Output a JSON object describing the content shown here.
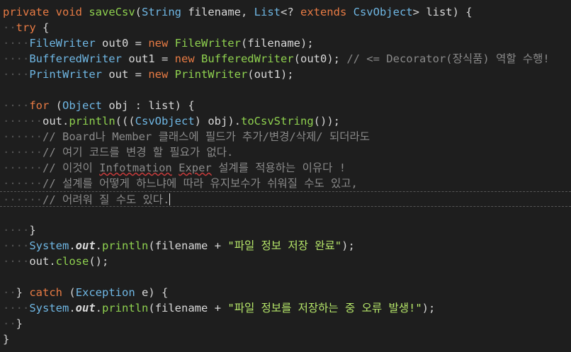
{
  "editor": {
    "language": "java",
    "lines": [
      [
        {
          "c": "kw",
          "t": "private "
        },
        {
          "c": "kw",
          "t": "void "
        },
        {
          "c": "fn",
          "t": "saveCsv"
        },
        {
          "c": "pun",
          "t": "("
        },
        {
          "c": "ty",
          "t": "String "
        },
        {
          "c": "var",
          "t": "filename"
        },
        {
          "c": "pun",
          "t": ", "
        },
        {
          "c": "ty",
          "t": "List"
        },
        {
          "c": "pun",
          "t": "<? "
        },
        {
          "c": "kw",
          "t": "extends "
        },
        {
          "c": "ty",
          "t": "CsvObject"
        },
        {
          "c": "pun",
          "t": "> "
        },
        {
          "c": "var",
          "t": "list"
        },
        {
          "c": "pun",
          "t": ") {"
        }
      ],
      [
        {
          "c": "ws",
          "t": "··"
        },
        {
          "c": "kw",
          "t": "try "
        },
        {
          "c": "pun",
          "t": "{"
        }
      ],
      [
        {
          "c": "ws",
          "t": "····"
        },
        {
          "c": "ty",
          "t": "FileWriter "
        },
        {
          "c": "var",
          "t": "out0 "
        },
        {
          "c": "pun",
          "t": "= "
        },
        {
          "c": "kw",
          "t": "new "
        },
        {
          "c": "fn",
          "t": "FileWriter"
        },
        {
          "c": "pun",
          "t": "("
        },
        {
          "c": "var",
          "t": "filename"
        },
        {
          "c": "pun",
          "t": ");"
        }
      ],
      [
        {
          "c": "ws",
          "t": "····"
        },
        {
          "c": "ty",
          "t": "BufferedWriter "
        },
        {
          "c": "var",
          "t": "out1 "
        },
        {
          "c": "pun",
          "t": "= "
        },
        {
          "c": "kw",
          "t": "new "
        },
        {
          "c": "fn",
          "t": "BufferedWriter"
        },
        {
          "c": "pun",
          "t": "("
        },
        {
          "c": "var",
          "t": "out0"
        },
        {
          "c": "pun",
          "t": "); "
        },
        {
          "c": "cmt",
          "t": "// <= Decorator(장식품) 역할 수행!"
        }
      ],
      [
        {
          "c": "ws",
          "t": "····"
        },
        {
          "c": "ty",
          "t": "PrintWriter "
        },
        {
          "c": "var",
          "t": "out "
        },
        {
          "c": "pun",
          "t": "= "
        },
        {
          "c": "kw",
          "t": "new "
        },
        {
          "c": "fn",
          "t": "PrintWriter"
        },
        {
          "c": "pun",
          "t": "("
        },
        {
          "c": "var",
          "t": "out1"
        },
        {
          "c": "pun",
          "t": ");"
        }
      ],
      [],
      [
        {
          "c": "ws",
          "t": "····"
        },
        {
          "c": "kw",
          "t": "for "
        },
        {
          "c": "pun",
          "t": "("
        },
        {
          "c": "ty",
          "t": "Object "
        },
        {
          "c": "var",
          "t": "obj "
        },
        {
          "c": "pun",
          "t": ": "
        },
        {
          "c": "var",
          "t": "list"
        },
        {
          "c": "pun",
          "t": ") {"
        }
      ],
      [
        {
          "c": "ws",
          "t": "······"
        },
        {
          "c": "var",
          "t": "out"
        },
        {
          "c": "pun",
          "t": "."
        },
        {
          "c": "fn",
          "t": "println"
        },
        {
          "c": "pun",
          "t": "((("
        },
        {
          "c": "ty",
          "t": "CsvObject"
        },
        {
          "c": "pun",
          "t": ") "
        },
        {
          "c": "var",
          "t": "obj"
        },
        {
          "c": "pun",
          "t": ")."
        },
        {
          "c": "fn",
          "t": "toCsvString"
        },
        {
          "c": "pun",
          "t": "());"
        }
      ],
      [
        {
          "c": "ws",
          "t": "······"
        },
        {
          "c": "cmt",
          "t": "// Board나 Member 클래스에 필드가 추가/변경/삭제/ 되더라도"
        }
      ],
      [
        {
          "c": "ws",
          "t": "······"
        },
        {
          "c": "cmt",
          "t": "// 여기 코드를 변경 할 필요가 없다."
        }
      ],
      [
        {
          "c": "ws",
          "t": "······"
        },
        {
          "c": "cmt",
          "t": "// 이것이 "
        },
        {
          "c": "cmt squiggle",
          "t": "Infotmation"
        },
        {
          "c": "cmt",
          "t": " "
        },
        {
          "c": "cmt squiggle",
          "t": "Exper"
        },
        {
          "c": "cmt",
          "t": " 설계를 적용하는 이유다 !"
        }
      ],
      [
        {
          "c": "ws",
          "t": "······"
        },
        {
          "c": "cmt",
          "t": "// 설계를 어떻게 하느냐에 따라 유지보수가 쉬워질 수도 있고,"
        }
      ],
      [
        {
          "c": "ws",
          "t": "······"
        },
        {
          "c": "cmt",
          "t": "// 어려워 질 수도 있다."
        }
      ],
      [],
      [
        {
          "c": "ws",
          "t": "····"
        },
        {
          "c": "pun",
          "t": "}"
        }
      ],
      [
        {
          "c": "ws",
          "t": "····"
        },
        {
          "c": "ty",
          "t": "System"
        },
        {
          "c": "pun",
          "t": "."
        },
        {
          "c": "field",
          "t": "out"
        },
        {
          "c": "pun",
          "t": "."
        },
        {
          "c": "fn",
          "t": "println"
        },
        {
          "c": "pun",
          "t": "("
        },
        {
          "c": "var",
          "t": "filename "
        },
        {
          "c": "pun",
          "t": "+ "
        },
        {
          "c": "str",
          "t": "\"파일 정보 저장 완료\""
        },
        {
          "c": "pun",
          "t": ");"
        }
      ],
      [
        {
          "c": "ws",
          "t": "····"
        },
        {
          "c": "var",
          "t": "out"
        },
        {
          "c": "pun",
          "t": "."
        },
        {
          "c": "fn",
          "t": "close"
        },
        {
          "c": "pun",
          "t": "();"
        }
      ],
      [],
      [
        {
          "c": "ws",
          "t": "··"
        },
        {
          "c": "pun",
          "t": "} "
        },
        {
          "c": "kw",
          "t": "catch "
        },
        {
          "c": "pun",
          "t": "("
        },
        {
          "c": "ty",
          "t": "Exception "
        },
        {
          "c": "var",
          "t": "e"
        },
        {
          "c": "pun",
          "t": ") {"
        }
      ],
      [
        {
          "c": "ws",
          "t": "····"
        },
        {
          "c": "ty",
          "t": "System"
        },
        {
          "c": "pun",
          "t": "."
        },
        {
          "c": "field",
          "t": "out"
        },
        {
          "c": "pun",
          "t": "."
        },
        {
          "c": "fn",
          "t": "println"
        },
        {
          "c": "pun",
          "t": "("
        },
        {
          "c": "var",
          "t": "filename "
        },
        {
          "c": "pun",
          "t": "+ "
        },
        {
          "c": "str",
          "t": "\"파일 정보를 저장하는 중 오류 발생!\""
        },
        {
          "c": "pun",
          "t": ");"
        }
      ],
      [
        {
          "c": "ws",
          "t": "··"
        },
        {
          "c": "pun",
          "t": "}"
        }
      ],
      [
        {
          "c": "pun",
          "t": "}"
        }
      ]
    ],
    "current_line": 12,
    "colors": {
      "background": "#1e1e1e",
      "keyword": "#e87b44",
      "type": "#6fb7e4",
      "method": "#8fd14f",
      "string": "#b7e86a",
      "comment": "#8a8a8a"
    }
  }
}
